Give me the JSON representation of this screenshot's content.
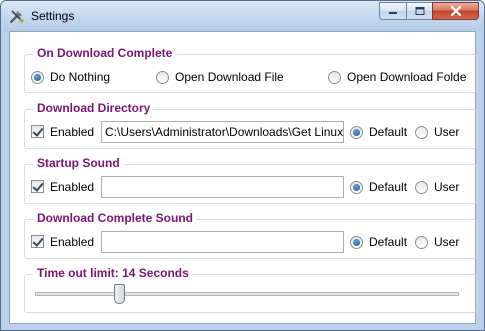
{
  "window": {
    "title": "Settings"
  },
  "groups": {
    "download_complete": {
      "title": "On Download Complete",
      "options": [
        {
          "label": "Do Nothing",
          "selected": true
        },
        {
          "label": "Open Download File",
          "selected": false
        },
        {
          "label": "Open Download Folde",
          "selected": false
        }
      ]
    },
    "download_directory": {
      "title": "Download Directory",
      "enabled_label": "Enabled",
      "enabled": true,
      "path": "C:\\Users\\Administrator\\Downloads\\Get Linux",
      "default_label": "Default",
      "user_label": "User",
      "selected": "Default"
    },
    "startup_sound": {
      "title": "Startup Sound",
      "enabled_label": "Enabled",
      "enabled": true,
      "path": "",
      "default_label": "Default",
      "user_label": "User",
      "selected": "Default"
    },
    "download_complete_sound": {
      "title": "Download Complete Sound",
      "enabled_label": "Enabled",
      "enabled": true,
      "path": "",
      "default_label": "Default",
      "user_label": "User",
      "selected": "Default"
    },
    "timeout": {
      "title": "Time out limit: 14 Seconds",
      "slider_fraction": 0.2
    }
  },
  "icons": {
    "app": "tools-icon",
    "minimize": "minimize-icon",
    "maximize": "maximize-icon",
    "close": "close-icon"
  },
  "colors": {
    "group_title": "#7b1576",
    "titlebar": "#c6daf0",
    "close_button": "#c2422a"
  }
}
